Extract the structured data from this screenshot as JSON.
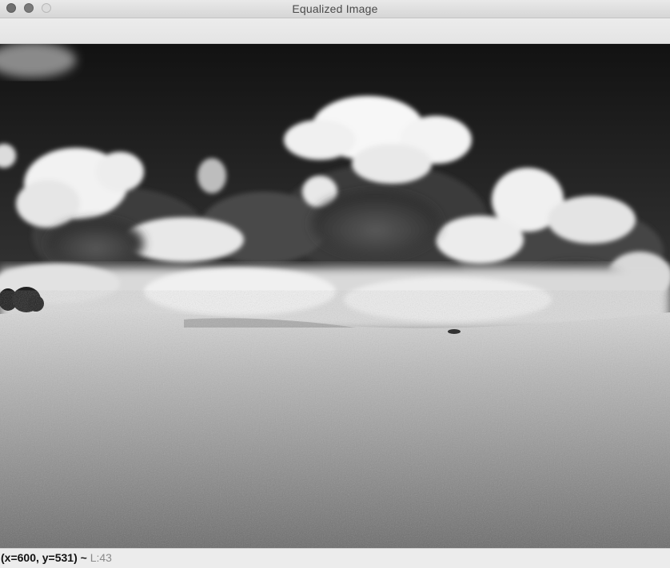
{
  "window": {
    "title": "Equalized Image"
  },
  "image": {
    "description_icon": "grayscale-landscape-image"
  },
  "status": {
    "coords": "(x=600, y=531)",
    "separator": " ~ ",
    "value": "L:43"
  },
  "colors": {
    "titlebar": "#dedede",
    "sky": "#1c1c1c",
    "cloud": "#f4f4f4",
    "field": "#9a9a9a"
  }
}
